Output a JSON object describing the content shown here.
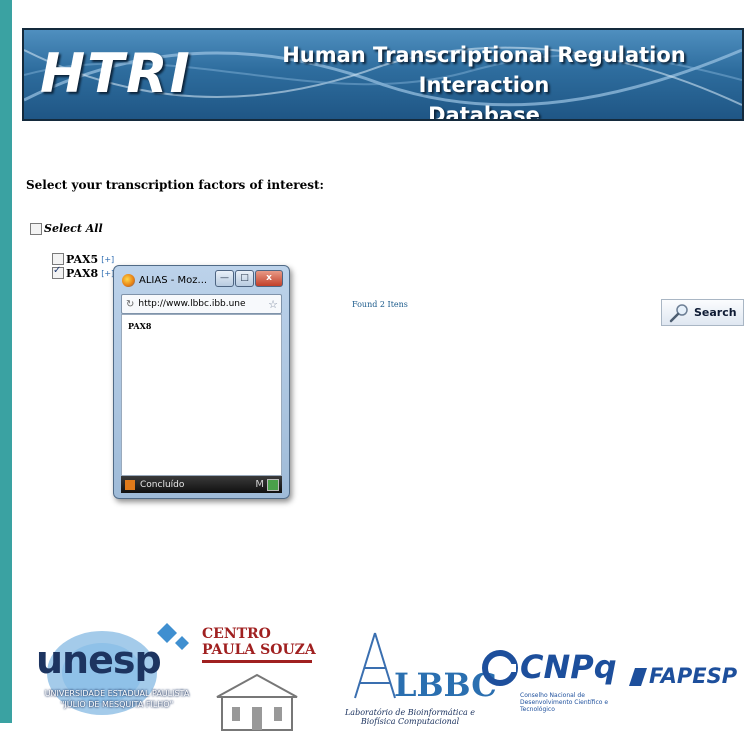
{
  "banner": {
    "logo": "HTRI",
    "title_line1": "Human Transcriptional Regulation Interaction",
    "title_line2": "Database"
  },
  "form": {
    "prompt": "Select your transcription factors of interest:",
    "select_all_label": "Select All",
    "factors": [
      {
        "name": "PAX5",
        "info": "[+]",
        "checked": false
      },
      {
        "name": "PAX8",
        "info": "[+]",
        "checked": true
      }
    ],
    "found_text": "Found 2 Itens",
    "search_label": "Search"
  },
  "popup": {
    "title": "ALIAS - Moz...",
    "minimize_glyph": "—",
    "maximize_glyph": "□",
    "close_glyph": "x",
    "url": "http://www.lbbc.ibb.une",
    "result": "PAX8",
    "status": "Concluído",
    "status_right": "M"
  },
  "footer": {
    "unesp_word": "unesp",
    "unesp_sub1": "UNIVERSIDADE ESTADUAL PAULISTA",
    "unesp_sub2": "\"JÚLIO DE MESQUITA FILHO\"",
    "cps_title": "CENTRO PAULA SOUZA",
    "lbbc_word": "LBBC",
    "lbbc_sub1": "Laboratório de Bioinformática e",
    "lbbc_sub2": "Biofísica Computacional",
    "cnpq_word": "CNPq",
    "cnpq_sub": "Conselho Nacional de Desenvolvimento Científico e Tecnológico",
    "fapesp_word": "FAPESP"
  }
}
